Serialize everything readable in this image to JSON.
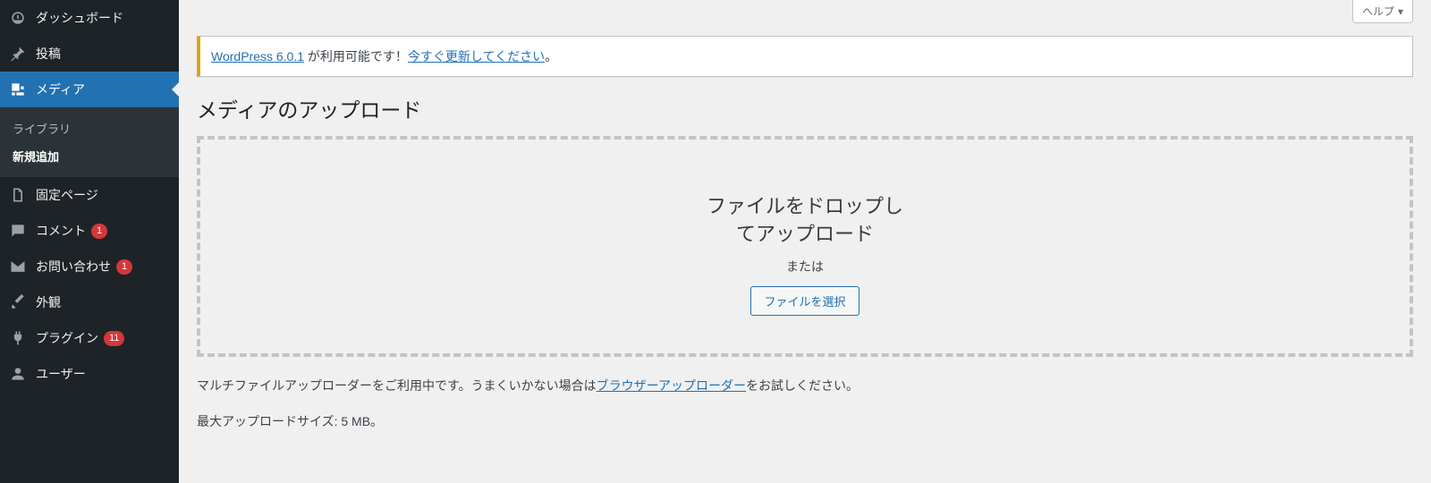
{
  "help_tab": "ヘルプ",
  "notice": {
    "link1": "WordPress 6.0.1",
    "middle": " が利用可能です！",
    "link2": "今すぐ更新してください",
    "tail": "。"
  },
  "page_title": "メディアのアップロード",
  "dropzone": {
    "drop_text": "ファイルをドロップしてアップロード",
    "or_text": "または",
    "select_btn": "ファイルを選択"
  },
  "below": {
    "pre": "マルチファイルアップローダーをご利用中です。うまくいかない場合は",
    "link": "ブラウザーアップローダー",
    "post": "をお試しください。"
  },
  "max_text": "最大アップロードサイズ: 5 MB。",
  "nav": {
    "dashboard": "ダッシュボード",
    "posts": "投稿",
    "media": "メディア",
    "pages": "固定ページ",
    "comments": "コメント",
    "comments_badge": "1",
    "inquiry": "お問い合わせ",
    "inquiry_badge": "1",
    "appearance": "外観",
    "plugins": "プラグイン",
    "plugins_badge": "11",
    "users": "ユーザー",
    "submenu": {
      "library": "ライブラリ",
      "add_new": "新規追加"
    }
  }
}
